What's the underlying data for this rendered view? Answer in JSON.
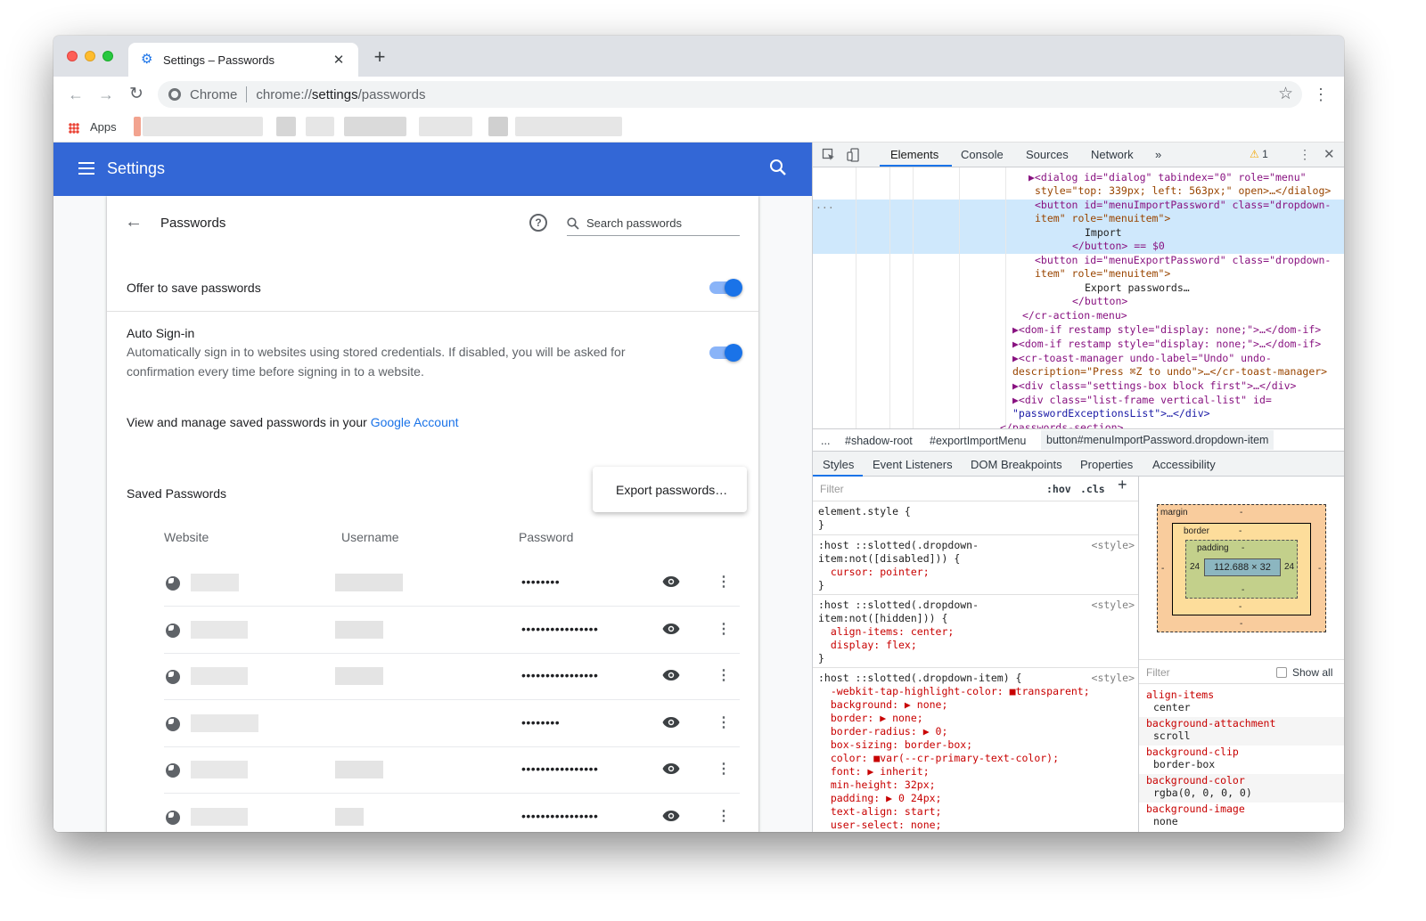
{
  "tab": {
    "title": "Settings – Passwords",
    "close": "✕",
    "new": "+"
  },
  "omnibox": {
    "site": "Chrome",
    "url_prefix": "chrome://",
    "url_bold": "settings",
    "url_suffix": "/passwords"
  },
  "bookmarks": {
    "apps_label": "Apps"
  },
  "settings": {
    "header_title": "Settings",
    "page_title": "Passwords",
    "search_placeholder": "Search passwords",
    "offer_label": "Offer to save passwords",
    "offer_enabled": true,
    "autosignin_label": "Auto Sign-in",
    "autosignin_enabled": true,
    "autosignin_desc": "Automatically sign in to websites using stored credentials. If disabled, you will be asked for confirmation every time before signing in to a website.",
    "manage_text": "View and manage saved passwords in your ",
    "manage_link": "Google Account",
    "saved_title": "Saved Passwords",
    "export_menu_item": "Export passwords…",
    "columns": [
      "Website",
      "Username",
      "Password"
    ],
    "rows": [
      {
        "password_mask": "••••••••"
      },
      {
        "password_mask": "••••••••••••••••"
      },
      {
        "password_mask": "••••••••••••••••"
      },
      {
        "password_mask": "••••••••"
      },
      {
        "password_mask": "••••••••••••••••"
      },
      {
        "password_mask": "••••••••••••••••"
      }
    ]
  },
  "devtools": {
    "tabs": [
      "Elements",
      "Console",
      "Sources",
      "Network"
    ],
    "overflow": "»",
    "warnings_count": "1",
    "dom": {
      "l1": "▶<dialog id=\"dialog\" tabindex=\"0\" role=\"menu\"",
      "l2": "style=\"top: 339px; left: 563px;\" open>…</dialog>",
      "l3": "<button id=\"menuImportPassword\" class=\"dropdown-",
      "l4": "item\" role=\"menuitem\">",
      "l5": "Import",
      "l6": "</button> == $0",
      "l7": "<button id=\"menuExportPassword\" class=\"dropdown-",
      "l8": "item\" role=\"menuitem\">",
      "l9": "Export passwords…",
      "l10": "</button>",
      "l11": "</cr-action-menu>",
      "l12": "▶<dom-if restamp style=\"display: none;\">…</dom-if>",
      "l13": "▶<dom-if restamp style=\"display: none;\">…</dom-if>",
      "l14": "▶<cr-toast-manager undo-label=\"Undo\" undo-",
      "l15": "description=\"Press ⌘Z to undo\">…</cr-toast-manager>",
      "l16": "▶<div class=\"settings-box block first\">…</div>",
      "l17": "▶<div class=\"list-frame vertical-list\" id=",
      "l18": "\"passwordExceptionsList\">…</div>",
      "l19": "</passwords-section>",
      "ellipsis": "..."
    },
    "breadcrumbs": [
      "...",
      "#shadow-root",
      "#exportImportMenu",
      "button#menuImportPassword.dropdown-item"
    ],
    "subtabs": [
      "Styles",
      "Event Listeners",
      "DOM Breakpoints",
      "Properties",
      "Accessibility"
    ],
    "styles": {
      "filter_placeholder": "Filter",
      "hov": ":hov",
      "cls": ".cls",
      "source": "<style>",
      "rules": [
        {
          "lines": [
            "element.style {",
            "}"
          ]
        },
        {
          "lines": [
            ":host ::slotted(.dropdown-",
            "item:not([disabled])) {",
            "  cursor: pointer;",
            "}"
          ]
        },
        {
          "lines": [
            ":host ::slotted(.dropdown-",
            "item:not([hidden])) {",
            "  align-items: center;",
            "  display: flex;",
            "}"
          ]
        },
        {
          "lines": [
            ":host ::slotted(.dropdown-item) {",
            "  -webkit-tap-highlight-color: ■transparent;",
            "  background: ▶ none;",
            "  border: ▶ none;",
            "  border-radius: ▶ 0;",
            "  box-sizing: border-box;",
            "  color: ■var(--cr-primary-text-color);",
            "  font: ▶ inherit;",
            "  min-height: 32px;",
            "  padding: ▶ 0 24px;",
            "  text-align: start;",
            "  user-select: none;"
          ]
        }
      ]
    },
    "box_model": {
      "margin_label": "margin",
      "border_label": "border",
      "padding_label": "padding",
      "content": "112.688 × 32",
      "padding_left": "24",
      "padding_right": "24",
      "dash": "-"
    },
    "computed": {
      "filter_placeholder": "Filter",
      "show_all": "Show all",
      "items": [
        {
          "name": "align-items",
          "value": "center"
        },
        {
          "name": "background-attachment",
          "value": "scroll"
        },
        {
          "name": "background-clip",
          "value": "border-box"
        },
        {
          "name": "background-color",
          "value": "rgba(0, 0, 0, 0)"
        },
        {
          "name": "background-image",
          "value": "none"
        }
      ]
    }
  }
}
